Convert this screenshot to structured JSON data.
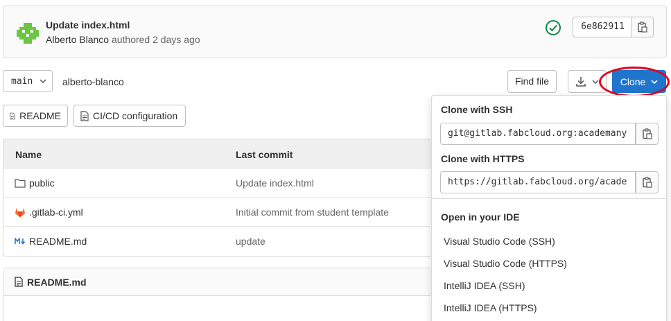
{
  "commit": {
    "title": "Update index.html",
    "author": "Alberto Blanco",
    "authored": "authored 2 days ago",
    "sha": "6e862911",
    "status_color": "#108548"
  },
  "toolbar": {
    "branch": "main",
    "breadcrumb": "alberto-blanco",
    "find_file": "Find file",
    "clone": "Clone",
    "clone_color": "#1f75cb",
    "highlight_color": "#e3001b"
  },
  "shortcuts": {
    "readme": "README",
    "cicd": "CI/CD configuration"
  },
  "table": {
    "headers": {
      "name": "Name",
      "last_commit": "Last commit"
    },
    "rows": [
      {
        "name": "public",
        "icon": "folder-icon",
        "commit": "Update index.html"
      },
      {
        "name": ".gitlab-ci.yml",
        "icon": "gitlab-icon",
        "commit": "Initial commit from student template"
      },
      {
        "name": "README.md",
        "icon": "markdown-icon",
        "commit": "update"
      }
    ]
  },
  "readme": {
    "title": "README.md"
  },
  "clone_dropdown": {
    "ssh_label": "Clone with SSH",
    "ssh_url": "git@gitlab.fabcloud.org:academany",
    "https_label": "Clone with HTTPS",
    "https_url": "https://gitlab.fabcloud.org/acade",
    "ide_label": "Open in your IDE",
    "ide_items": [
      "Visual Studio Code (SSH)",
      "Visual Studio Code (HTTPS)",
      "IntelliJ IDEA (SSH)",
      "IntelliJ IDEA (HTTPS)"
    ]
  }
}
